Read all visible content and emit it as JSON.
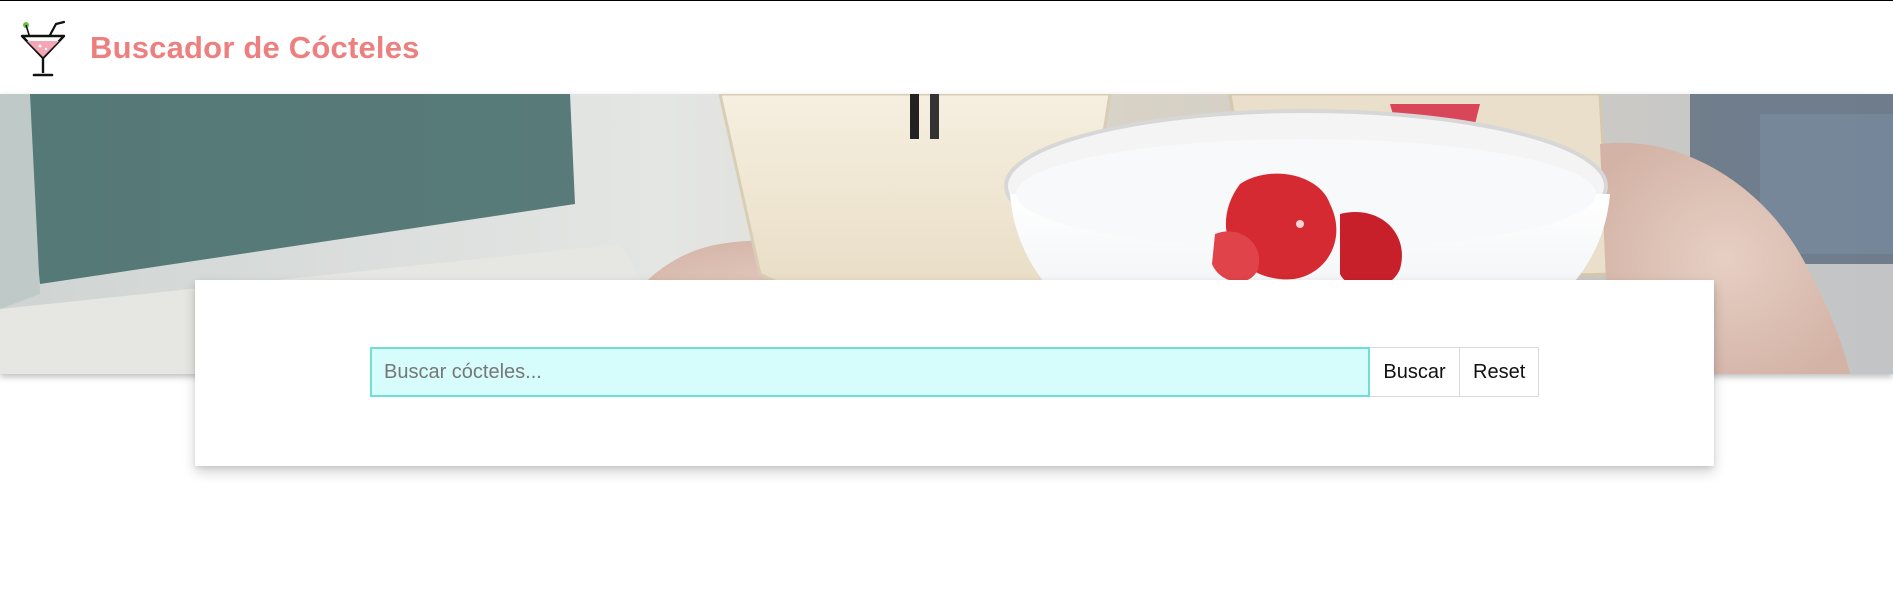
{
  "header": {
    "title": "Buscador de Cócteles",
    "logo_icon": "cocktail-glass-icon",
    "title_color": "#ee7f7f"
  },
  "hero": {
    "image": "cocktails-toast-photo"
  },
  "search": {
    "placeholder": "Buscar cócteles...",
    "value": "",
    "search_button": "Buscar",
    "reset_button": "Reset",
    "input_background": "#d6fcfc",
    "input_border": "#6fe0d3"
  }
}
